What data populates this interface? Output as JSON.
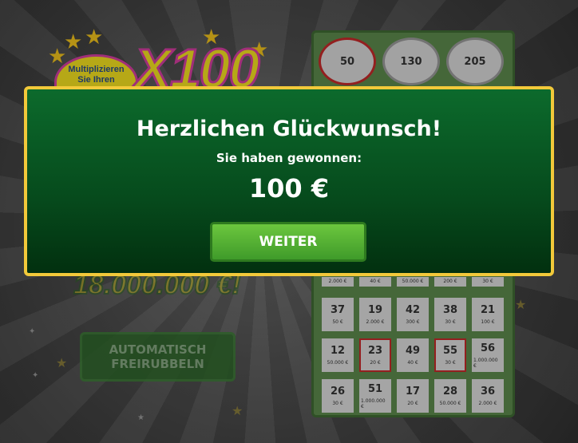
{
  "logo": {
    "multiplier_text_line1": "Multiplizieren",
    "multiplier_text_line2": "Sie Ihren",
    "game_name": "X100"
  },
  "jackpot": {
    "amount_text": "18.000.000 €!"
  },
  "auto_button": {
    "line1": "AUTOMATISCH",
    "line2": "FREIRUBBELN"
  },
  "winning_numbers": [
    {
      "value": "50",
      "hit": true
    },
    {
      "value": "130",
      "hit": false
    },
    {
      "value": "205",
      "hit": false
    }
  ],
  "partial_row_prizes": [
    "2.000 €",
    "40 €",
    "50.000 €",
    "200 €",
    "30 €"
  ],
  "grid": [
    {
      "n": "37",
      "p": "50 €",
      "hit": false
    },
    {
      "n": "19",
      "p": "2.000 €",
      "hit": false
    },
    {
      "n": "42",
      "p": "300 €",
      "hit": false
    },
    {
      "n": "38",
      "p": "30 €",
      "hit": false
    },
    {
      "n": "21",
      "p": "100 €",
      "hit": false
    },
    {
      "n": "12",
      "p": "50.000 €",
      "hit": false
    },
    {
      "n": "23",
      "p": "20 €",
      "hit": true
    },
    {
      "n": "49",
      "p": "40 €",
      "hit": false
    },
    {
      "n": "55",
      "p": "30 €",
      "hit": true
    },
    {
      "n": "56",
      "p": "1.000.000 €",
      "hit": false
    },
    {
      "n": "26",
      "p": "30 €",
      "hit": false
    },
    {
      "n": "51",
      "p": "1.000.000 €",
      "hit": false
    },
    {
      "n": "17",
      "p": "20 €",
      "hit": false
    },
    {
      "n": "28",
      "p": "50.000 €",
      "hit": false
    },
    {
      "n": "36",
      "p": "2.000 €",
      "hit": false
    }
  ],
  "modal": {
    "title": "Herzlichen Glückwunsch!",
    "subtitle": "Sie haben gewonnen:",
    "amount": "100 €",
    "button_label": "WEITER"
  },
  "colors": {
    "modal_border": "#f2c93a",
    "modal_green": "#0c6a2c",
    "button_green": "#6cc63e",
    "card_green": "#5d8a4c",
    "hit_red": "#c42a2a"
  }
}
